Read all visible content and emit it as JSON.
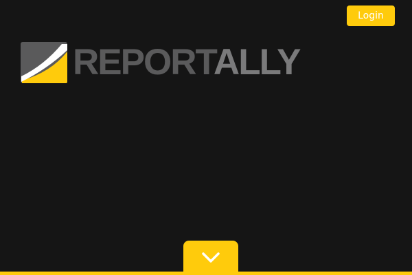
{
  "header": {
    "login_label": "Login"
  },
  "logo": {
    "text_part1": "REPORT",
    "text_part2": "ALLY",
    "icon": "reportally-logo-mark"
  },
  "scroll_button": {
    "icon": "chevron-down-icon"
  },
  "colors": {
    "background": "#151515",
    "accent": "#ffcb0c",
    "logo_text_dark": "#5a5a5b",
    "logo_text_light": "#7a7a7b"
  }
}
